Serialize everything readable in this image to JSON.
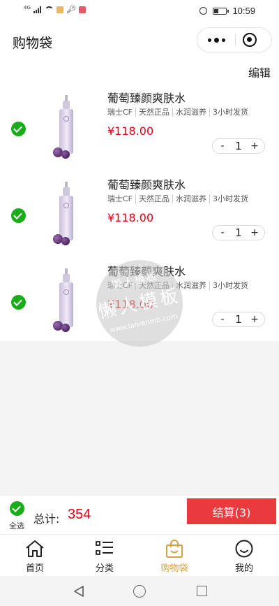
{
  "status_bar": {
    "network": "4G",
    "time": "10:59",
    "battery_level": 0.35,
    "icons": [
      "signal-icon",
      "wifi-icon",
      "app-notification-icon",
      "key-icon",
      "app-notification-icon",
      "alarm-icon",
      "battery-icon"
    ]
  },
  "header": {
    "title": "购物袋",
    "more_icon": "more-dots-icon",
    "close_icon": "target-close-icon"
  },
  "edit_label": "编辑",
  "cart": {
    "items": [
      {
        "name": "葡萄臻颜爽肤水",
        "tags": [
          "瑞士CF",
          "天然正品",
          "水润滋养",
          "3小时发货"
        ],
        "price": "¥118.00",
        "qty": "1",
        "selected": true
      },
      {
        "name": "葡萄臻颜爽肤水",
        "tags": [
          "瑞士CF",
          "天然正品",
          "水润滋养",
          "3小时发货"
        ],
        "price": "¥118.00",
        "qty": "1",
        "selected": true
      },
      {
        "name": "葡萄臻颜爽肤水",
        "tags": [
          "瑞士CF",
          "天然正品",
          "水润滋养",
          "3小时发货"
        ],
        "price": "¥118.00",
        "qty": "1",
        "selected": true
      }
    ],
    "minus_label": "-",
    "plus_label": "+"
  },
  "watermark": {
    "line1": "懒人模板",
    "line2": "懒人模板",
    "line3": "www.lanrenmb.com"
  },
  "checkout": {
    "select_all_label": "全选",
    "total_label": "总计:",
    "total_value": "354",
    "settle_label": "结算(3)"
  },
  "tabbar": {
    "tabs": [
      {
        "label": "首页",
        "icon": "home-icon",
        "active": false
      },
      {
        "label": "分类",
        "icon": "category-list-icon",
        "active": false
      },
      {
        "label": "购物袋",
        "icon": "shopping-bag-icon",
        "active": true
      },
      {
        "label": "我的",
        "icon": "smiley-profile-icon",
        "active": false
      }
    ]
  },
  "colors": {
    "accent_green": "#1aad19",
    "price_red": "#e60012",
    "settle_red": "#e93b3d",
    "tab_active": "#d9a13b"
  }
}
